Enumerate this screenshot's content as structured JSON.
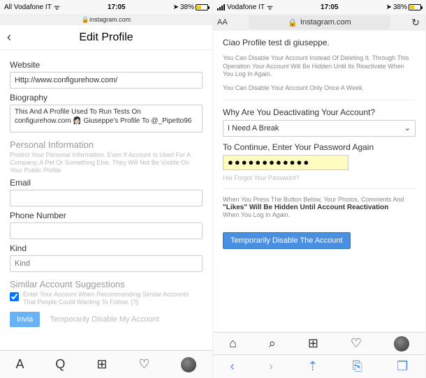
{
  "left": {
    "status": {
      "carrier": "All Vodafone IT",
      "time": "17:05",
      "battery": "38%"
    },
    "url": "instagram.com",
    "header": {
      "title": "Edit Profile"
    },
    "form": {
      "website_label": "Website",
      "website_value": "Http://www.configurehow.com/",
      "bio_label": "Biography",
      "bio_value": "This And A Profile Used To Run Tests On configurehow.com 👩🏻 Giuseppe's Profile To @_Pipetto96",
      "personal_h": "Personal Information",
      "personal_sub": "Protect Your Personal Information. Even If Account Is Used For A Company, A Pet Or Something Else. They Will Not Be Visible On Your Public Profile",
      "email_label": "Email",
      "email_value": "",
      "phone_label": "Phone Number",
      "phone_value": "",
      "kind_label": "Kind",
      "kind_placeholder": "Kind",
      "similar_h": "Similar Account Suggestions",
      "similar_text": "Enter Your Account When Recommending Similar Accounts That People Could Wanting To Follow. [?]",
      "submit": "Invia",
      "disable_link": "Temporarily Disable My Account"
    },
    "bottom_nav": {
      "aa": "A",
      "q": "Q",
      "plus": "⊞",
      "heart": "♡"
    }
  },
  "right": {
    "status": {
      "carrier": "Vodafone IT",
      "time": "17:05",
      "battery": "38%"
    },
    "addr": {
      "aa": "AA",
      "host": "Instagram.com",
      "reload": "↻"
    },
    "body": {
      "greet": "Ciao Profile test di giuseppe.",
      "p1": "You Can Disable Your Account Instead Of Deleting It. Through This Operation Your Account Will Be Hidden Until Its Reactivate When You Log In Again.",
      "p2": "You Can Disable Your Account Only Once A Week.",
      "q": "Why Are You Deactivating Your Account?",
      "select_value": "I Need A Break",
      "pw_label": "To Continue, Enter Your Password Again",
      "pw_value": "●●●●●●●●●●●●",
      "forgot": "Hai Forgot Your Password?",
      "p3a": "When You Press The Button Below, Your Photos, Comments And",
      "p3b": "\"Likes\" Will Be Hidden Until Account Reactivation",
      "p3c": "When You Log In Again.",
      "btn": "Temporarily Disable The Account"
    },
    "ig_nav": {
      "home": "⌂",
      "search": "⌕",
      "plus": "⊞",
      "heart": "♡"
    },
    "safari": {
      "back": "‹",
      "fwd": "›",
      "share": "⇡",
      "book": "⎘",
      "tabs": "❐"
    }
  }
}
